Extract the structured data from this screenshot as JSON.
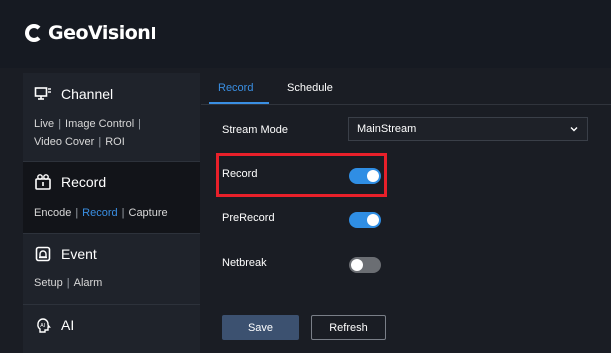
{
  "brand": {
    "name": "GeoVision"
  },
  "sidebar": {
    "channel": {
      "title": "Channel",
      "links": [
        "Live",
        "Image Control",
        "Video Cover",
        "ROI"
      ]
    },
    "record": {
      "title": "Record",
      "links": [
        "Encode",
        "Record",
        "Capture"
      ]
    },
    "event": {
      "title": "Event",
      "links": [
        "Setup",
        "Alarm"
      ]
    },
    "ai": {
      "title": "AI"
    }
  },
  "tabs": [
    "Record",
    "Schedule"
  ],
  "form": {
    "stream_mode": {
      "label": "Stream Mode",
      "value": "MainStream"
    },
    "record": {
      "label": "Record",
      "enabled": true
    },
    "prerecord": {
      "label": "PreRecord",
      "enabled": true
    },
    "netbreak": {
      "label": "Netbreak",
      "enabled": false
    }
  },
  "buttons": {
    "save": "Save",
    "refresh": "Refresh"
  },
  "colors": {
    "accent": "#3a8fe3",
    "highlight": "#e8202a",
    "toggle_off": "#6b6e73"
  }
}
